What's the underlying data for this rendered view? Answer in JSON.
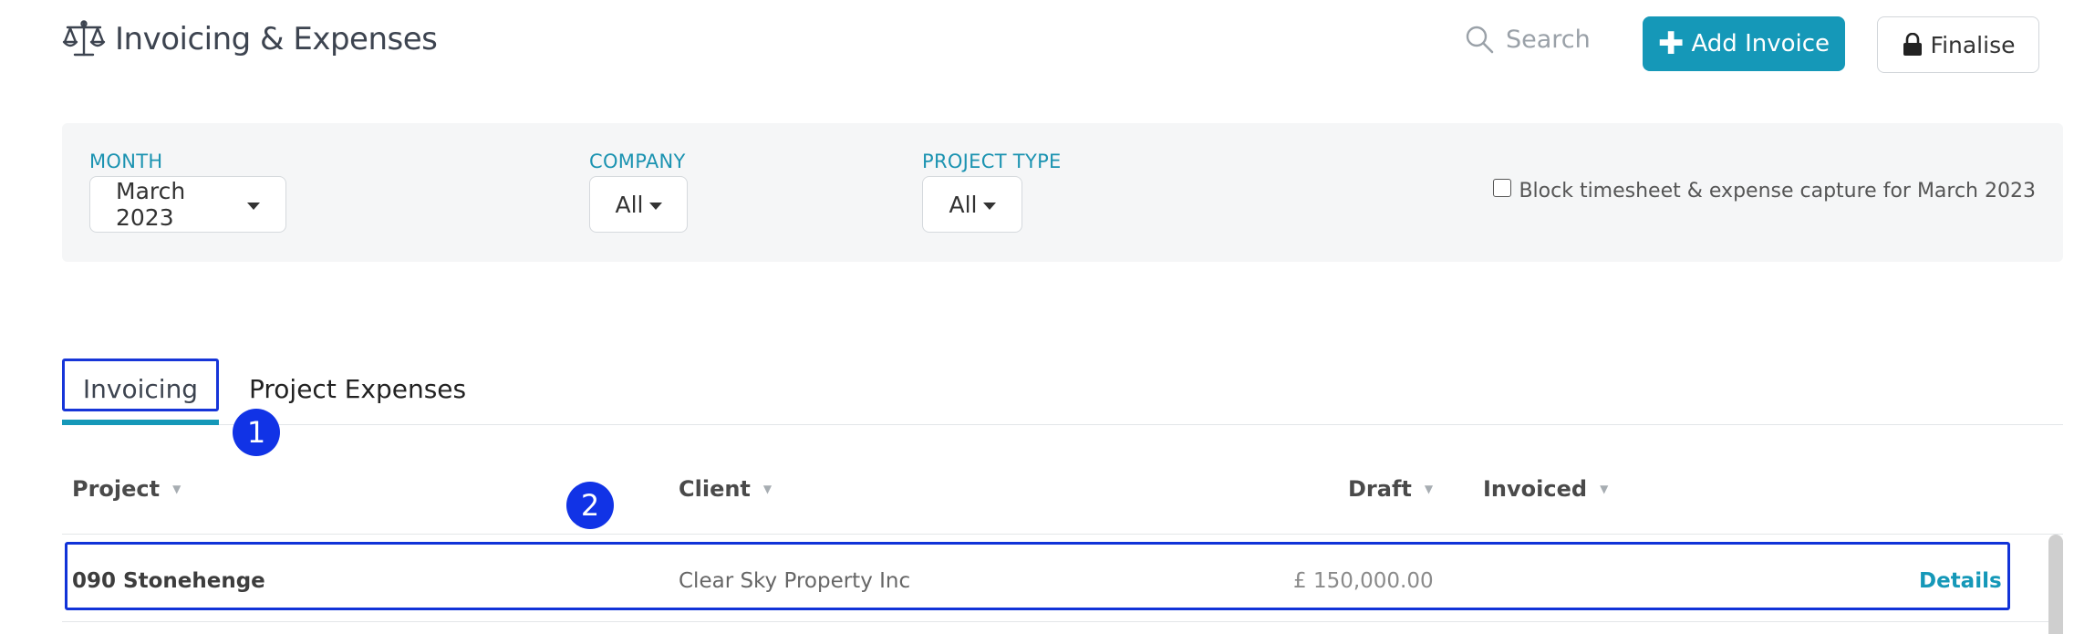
{
  "header": {
    "title": "Invoicing & Expenses",
    "search_label": "Search",
    "add_invoice_label": "Add Invoice",
    "finalise_label": "Finalise",
    "accent_color": "#1598b8"
  },
  "filters": {
    "month": {
      "label": "MONTH",
      "value": "March 2023"
    },
    "company": {
      "label": "COMPANY",
      "value": "All"
    },
    "project_type": {
      "label": "PROJECT TYPE",
      "value": "All"
    },
    "block_capture": {
      "label": "Block timesheet & expense capture for March 2023",
      "checked": false
    }
  },
  "tabs": [
    {
      "label": "Invoicing",
      "active": true
    },
    {
      "label": "Project Expenses",
      "active": false
    }
  ],
  "annotations": [
    "1",
    "2"
  ],
  "table": {
    "columns": [
      "Project",
      "Client",
      "Draft",
      "Invoiced"
    ],
    "rows": [
      {
        "project": "090 Stonehenge",
        "client": "Clear Sky Property Inc",
        "draft": "£ 150,000.00",
        "invoiced": "",
        "action": "Details"
      }
    ]
  }
}
